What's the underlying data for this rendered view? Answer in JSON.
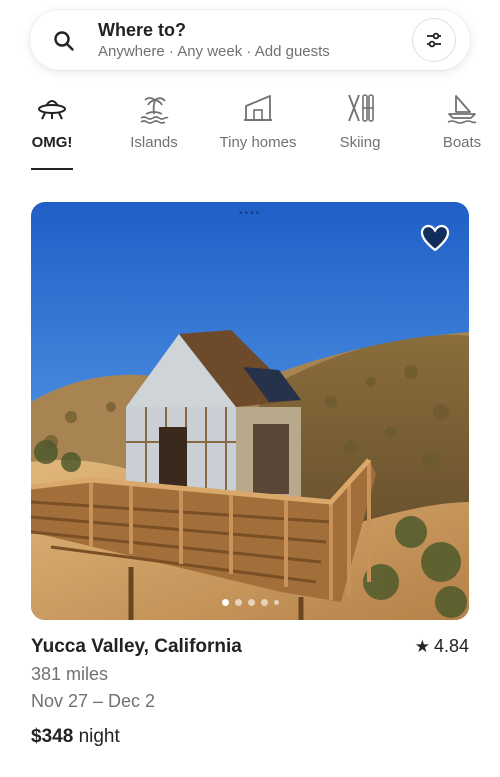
{
  "search": {
    "title": "Where to?",
    "subtitle": "Anywhere · Any week · Add guests"
  },
  "categories": [
    {
      "label": "OMG!",
      "icon": "ufo-icon",
      "active": true
    },
    {
      "label": "Islands",
      "icon": "island-icon",
      "active": false
    },
    {
      "label": "Tiny homes",
      "icon": "tiny-home-icon",
      "active": false
    },
    {
      "label": "Skiing",
      "icon": "skis-icon",
      "active": false
    },
    {
      "label": "Boats",
      "icon": "boat-icon",
      "active": false
    }
  ],
  "listing": {
    "title": "Yucca Valley, California",
    "rating": "4.84",
    "distance": "381 miles",
    "dates": "Nov 27 – Dec 2",
    "price": "$348",
    "price_unit": "night",
    "image_count": 5,
    "current_image_index": 0
  },
  "colors": {
    "text_primary": "#222222",
    "text_secondary": "#717171"
  }
}
